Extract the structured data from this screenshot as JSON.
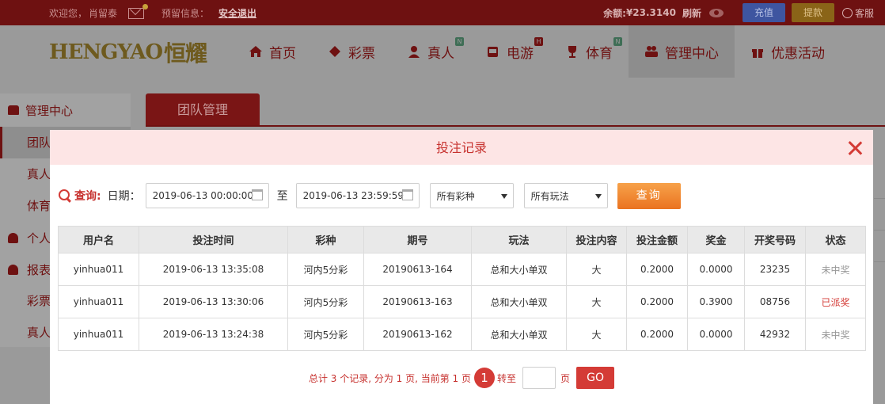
{
  "topbar": {
    "welcome": "欢迎您，",
    "username": "肖留泰",
    "reserve_info": "预留信息：",
    "logout": "安全退出",
    "balance_label": "余额: ",
    "balance_value": "¥23.3140",
    "refresh": "刷新",
    "recharge": "充值",
    "withdraw": "提款",
    "customer_service": "客服"
  },
  "logo": {
    "latin": "HENGYAO",
    "cn": "恒耀"
  },
  "nav": [
    {
      "label": "首页",
      "icon": "home-icon",
      "badge": ""
    },
    {
      "label": "彩票",
      "icon": "lottery-ticket-icon",
      "badge": ""
    },
    {
      "label": "真人",
      "icon": "dealer-icon",
      "badge": "N"
    },
    {
      "label": "电游",
      "icon": "slot-machine-icon",
      "badge": "H"
    },
    {
      "label": "体育",
      "icon": "trophy-icon",
      "badge": "N"
    },
    {
      "label": "管理中心",
      "icon": "users-icon",
      "badge": ""
    },
    {
      "label": "优惠活动",
      "icon": "gift-icon",
      "badge": ""
    }
  ],
  "sidebar": {
    "head": "管理中心",
    "items": [
      "团队",
      "真人",
      "体育"
    ],
    "sub1": "个人",
    "sub2": "报表",
    "items2": [
      "彩票",
      "真人"
    ]
  },
  "tab_active": "团队管理",
  "modal": {
    "title": "投注记录",
    "query_label": "查询:",
    "date_label": "日期：",
    "date_from": "2019-06-13 00:00:00",
    "to": "至",
    "date_to": "2019-06-13 23:59:59",
    "lottery_select": "所有彩种",
    "play_select": "所有玩法",
    "query_button": "查询",
    "columns": [
      "用户名",
      "投注时间",
      "彩种",
      "期号",
      "玩法",
      "投注内容",
      "投注金额",
      "奖金",
      "开奖号码",
      "状态"
    ],
    "rows": [
      [
        "yinhua011",
        "2019-06-13 13:35:08",
        "河内5分彩",
        "20190613-164",
        "总和大小单双",
        "大",
        "0.2000",
        "0.0000",
        "23235",
        "未中奖"
      ],
      [
        "yinhua011",
        "2019-06-13 13:30:06",
        "河内5分彩",
        "20190613-163",
        "总和大小单双",
        "大",
        "0.2000",
        "0.3900",
        "08756",
        "已派奖"
      ],
      [
        "yinhua011",
        "2019-06-13 13:24:38",
        "河内5分彩",
        "20190613-162",
        "总和大小单双",
        "大",
        "0.2000",
        "0.0000",
        "42932",
        "未中奖"
      ]
    ],
    "pager": {
      "summary": "总计 3 个记录, 分为 1 页, 当前第 1 页",
      "current": "1",
      "goto": "转至",
      "page_unit": "页",
      "go": "GO"
    }
  }
}
